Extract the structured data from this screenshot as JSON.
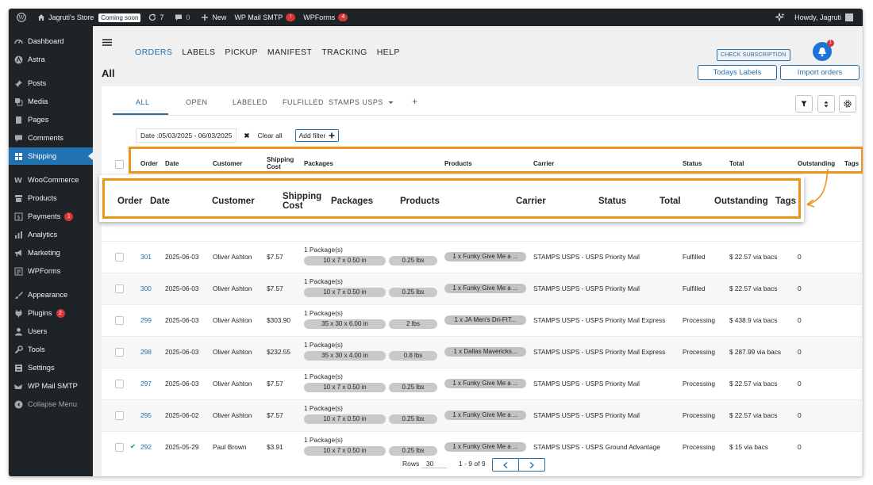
{
  "adminbar": {
    "site_name": "Jagruti's Store",
    "coming_soon": "Coming soon",
    "updates_count": "7",
    "comments_count": "0",
    "new_label": "New",
    "smtp_label": "WP Mail SMTP",
    "smtp_badge": "!",
    "wpforms_label": "WPForms",
    "wpforms_count": "4",
    "howdy": "Howdy, Jagruti"
  },
  "sidebar": {
    "items": [
      {
        "label": "Dashboard"
      },
      {
        "label": "Astra"
      },
      {
        "label": "Posts"
      },
      {
        "label": "Media"
      },
      {
        "label": "Pages"
      },
      {
        "label": "Comments"
      },
      {
        "label": "Shipping"
      },
      {
        "label": "WooCommerce"
      },
      {
        "label": "Products"
      },
      {
        "label": "Payments",
        "count": "1"
      },
      {
        "label": "Analytics"
      },
      {
        "label": "Marketing"
      },
      {
        "label": "WPForms"
      },
      {
        "label": "Appearance"
      },
      {
        "label": "Plugins",
        "count": "2"
      },
      {
        "label": "Users"
      },
      {
        "label": "Tools"
      },
      {
        "label": "Settings"
      },
      {
        "label": "WP Mail SMTP"
      },
      {
        "label": "Collapse Menu"
      }
    ]
  },
  "topnav": {
    "links": [
      "ORDERS",
      "LABELS",
      "PICKUP",
      "MANIFEST",
      "TRACKING",
      "HELP"
    ],
    "check_subscription": "CHECK SUBSCRIPTION",
    "bell_count": "1"
  },
  "page": {
    "title": "All",
    "todays_labels": "Todays Labels",
    "import_orders": "Import orders"
  },
  "tabs": [
    "ALL",
    "OPEN",
    "LABELED",
    "FULFILLED",
    "STAMPS USPS",
    "+"
  ],
  "filters": {
    "date_chip": "Date :05/03/2025 - 06/03/2025",
    "clear_all": "Clear all",
    "add_filter": "Add filter"
  },
  "columns": [
    "Order",
    "Date",
    "Customer",
    "Shipping Cost",
    "Packages",
    "Products",
    "Carrier",
    "Status",
    "Total",
    "Outstanding",
    "Tags"
  ],
  "zoom_columns": [
    "Order",
    "Date",
    "Customer",
    "Shipping\nCost",
    "Packages",
    "Products",
    "Carrier",
    "Status",
    "Total",
    "Outstanding",
    "Tags"
  ],
  "rows": [
    {
      "order": "301",
      "date": "2025-06-03",
      "customer": "Oliver Ashton",
      "cost": "$7.57",
      "pkg": "1 Package(s)",
      "dims": "10 x 7 x 0.50 in",
      "weight": "0.25 lbs",
      "product": "1 x Funky Give Me a ...",
      "carrier": "STAMPS USPS - USPS Priority Mail",
      "status": "Fulfilled",
      "total": "$ 22.57 via bacs",
      "outstanding": "0",
      "check": ""
    },
    {
      "order": "300",
      "date": "2025-06-03",
      "customer": "Oliver Ashton",
      "cost": "$7.57",
      "pkg": "1 Package(s)",
      "dims": "10 x 7 x 0.50 in",
      "weight": "0.25 lbs",
      "product": "1 x Funky Give Me a ...",
      "carrier": "STAMPS USPS - USPS Priority Mail",
      "status": "Fulfilled",
      "total": "$ 22.57 via bacs",
      "outstanding": "0",
      "check": ""
    },
    {
      "order": "299",
      "date": "2025-06-03",
      "customer": "Oliver Ashton",
      "cost": "$303.90",
      "pkg": "1 Package(s)",
      "dims": "35 x 30 x 6.00 in",
      "weight": "2 lbs",
      "product": "1 x JA Men's Dri-FIT...",
      "carrier": "STAMPS USPS - USPS Priority Mail Express",
      "status": "Processing",
      "total": "$ 438.9 via bacs",
      "outstanding": "0",
      "check": ""
    },
    {
      "order": "298",
      "date": "2025-06-03",
      "customer": "Oliver Ashton",
      "cost": "$232.55",
      "pkg": "1 Package(s)",
      "dims": "35 x 30 x 4.00 in",
      "weight": "0.8 lbs",
      "product": "1 x Dallas Mavericks...",
      "carrier": "STAMPS USPS - USPS Priority Mail Express",
      "status": "Processing",
      "total": "$ 287.99 via bacs",
      "outstanding": "0",
      "check": ""
    },
    {
      "order": "297",
      "date": "2025-06-03",
      "customer": "Oliver Ashton",
      "cost": "$7.57",
      "pkg": "1 Package(s)",
      "dims": "10 x 7 x 0.50 in",
      "weight": "0.25 lbs",
      "product": "1 x Funky Give Me a ...",
      "carrier": "STAMPS USPS - USPS Priority Mail",
      "status": "Processing",
      "total": "$ 22.57 via bacs",
      "outstanding": "0",
      "check": ""
    },
    {
      "order": "295",
      "date": "2025-06-02",
      "customer": "Oliver Ashton",
      "cost": "$7.57",
      "pkg": "1 Package(s)",
      "dims": "10 x 7 x 0.50 in",
      "weight": "0.25 lbs",
      "product": "1 x Funky Give Me a ...",
      "carrier": "STAMPS USPS - USPS Priority Mail",
      "status": "Processing",
      "total": "$ 22.57 via bacs",
      "outstanding": "0",
      "check": ""
    },
    {
      "order": "292",
      "date": "2025-05-29",
      "customer": "Paul Brown",
      "cost": "$3.91",
      "pkg": "1 Package(s)",
      "dims": "10 x 7 x 0.50 in",
      "weight": "0.25 lbs",
      "product": "1 x Funky Give Me a ...",
      "carrier": "STAMPS USPS - USPS Ground Advantage",
      "status": "Processing",
      "total": "$ 15 via bacs",
      "outstanding": "0",
      "check": "✔"
    }
  ],
  "pagination": {
    "rows_label": "Rows",
    "rows_value": "30",
    "range": "1 - 9 of 9"
  },
  "colors": {
    "accent": "#2271b1",
    "highlight": "#f0921a",
    "adminbar": "#1d2327"
  }
}
